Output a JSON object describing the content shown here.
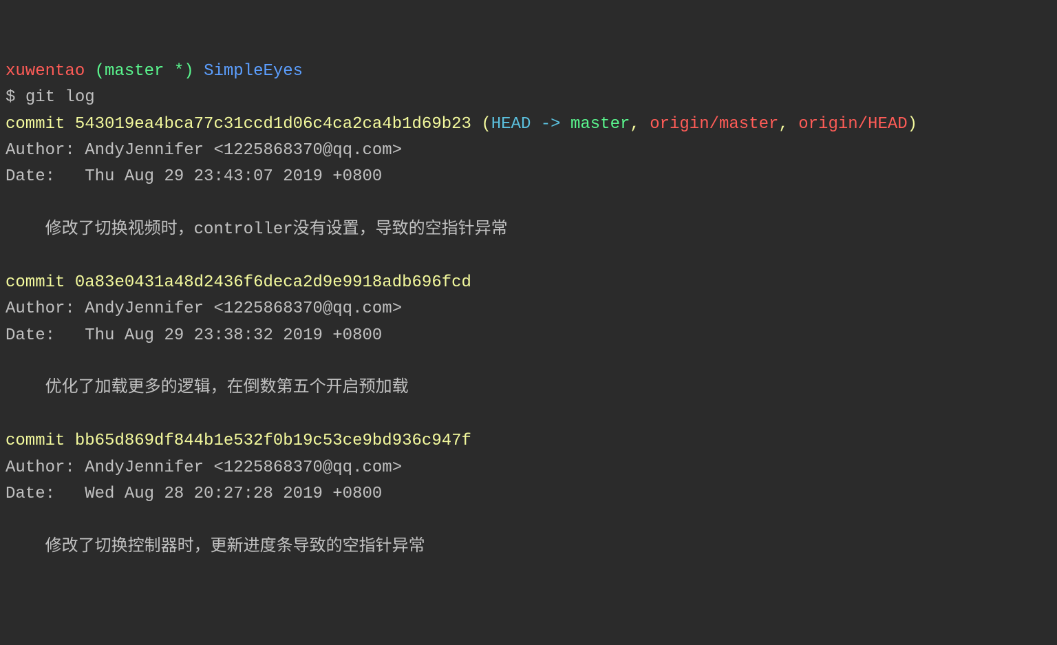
{
  "prompt": {
    "user": "xuwentao",
    "branch_open": " (",
    "branch": "master *",
    "branch_close": ") ",
    "repo": "SimpleEyes"
  },
  "command": {
    "symbol": "$ ",
    "text": "git log"
  },
  "commits": [
    {
      "label": "commit ",
      "hash": "543019ea4bca77c31ccd1d06c4ca2ca4b1d69b23",
      "refs": {
        "open": " (",
        "head": "HEAD -> ",
        "master": "master",
        "sep1": ", ",
        "origin_master": "origin/master",
        "sep2": ", ",
        "origin_head": "origin/HEAD",
        "close": ")"
      },
      "author_label": "Author: ",
      "author": "AndyJennifer <1225868370@qq.com>",
      "date_label": "Date:   ",
      "date": "Thu Aug 29 23:43:07 2019 +0800",
      "message": "    修改了切换视频时，controller没有设置，导致的空指针异常"
    },
    {
      "label": "commit ",
      "hash": "0a83e0431a48d2436f6deca2d9e9918adb696fcd",
      "author_label": "Author: ",
      "author": "AndyJennifer <1225868370@qq.com>",
      "date_label": "Date:   ",
      "date": "Thu Aug 29 23:38:32 2019 +0800",
      "message": "    优化了加载更多的逻辑，在倒数第五个开启预加载"
    },
    {
      "label": "commit ",
      "hash": "bb65d869df844b1e532f0b19c53ce9bd936c947f",
      "author_label": "Author: ",
      "author": "AndyJennifer <1225868370@qq.com>",
      "date_label": "Date:   ",
      "date": "Wed Aug 28 20:27:28 2019 +0800",
      "message": "    修改了切换控制器时，更新进度条导致的空指针异常"
    }
  ]
}
